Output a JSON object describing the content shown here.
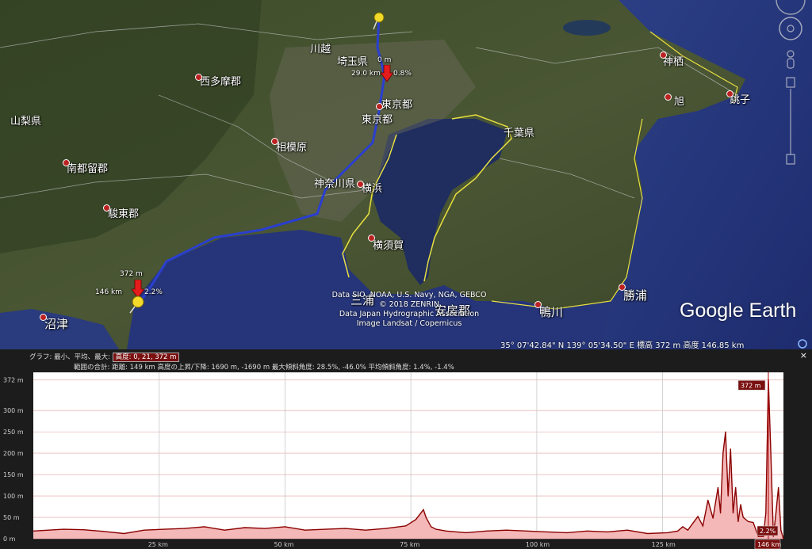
{
  "map": {
    "places": [
      {
        "name": "川越",
        "id": "kawagoe"
      },
      {
        "name": "埼玉県",
        "id": "saitama"
      },
      {
        "name": "神栖",
        "id": "kamisu"
      },
      {
        "name": "西多摩郡",
        "id": "nishitama"
      },
      {
        "name": "東京都",
        "id": "tokyo1"
      },
      {
        "name": "東京都",
        "id": "tokyo2"
      },
      {
        "name": "旭",
        "id": "asahi"
      },
      {
        "name": "銚子",
        "id": "choshi"
      },
      {
        "name": "山梨県",
        "id": "yamanashi"
      },
      {
        "name": "千葉県",
        "id": "chiba"
      },
      {
        "name": "相模原",
        "id": "sagamihara"
      },
      {
        "name": "南都留郡",
        "id": "minamitsuru"
      },
      {
        "name": "神奈川県",
        "id": "kanagawa"
      },
      {
        "name": "横浜",
        "id": "yokohama"
      },
      {
        "name": "駿東郡",
        "id": "sunto"
      },
      {
        "name": "横須賀",
        "id": "yokosuka"
      },
      {
        "name": "勝浦",
        "id": "katsuura"
      },
      {
        "name": "三浦",
        "id": "miura"
      },
      {
        "name": "安房郡",
        "id": "awa"
      },
      {
        "name": "鴨川",
        "id": "kamogawa"
      },
      {
        "name": "沼津",
        "id": "numazu"
      }
    ],
    "markers": {
      "top_altitude": "0 m",
      "top_distance": "29.0 km",
      "top_grade": "0.8%",
      "bottom_altitude": "372 m",
      "bottom_distance": "146 km",
      "bottom_grade": "2.2%"
    },
    "attribution": [
      "Data SIO, NOAA, U.S. Navy, NGA, GEBCO",
      "© 2018 ZENRIN",
      "Data Japan Hydrographic Association",
      "Image Landsat / Copernicus"
    ],
    "logo": "Google Earth",
    "status": "35° 07'42.84\" N  139° 05'34.50\" E  標高   372 m    高度 146.85 km"
  },
  "panel": {
    "line1_prefix": "グラフ: 最小、平均、最大:",
    "line1_badge": "高度: 0, 21, 372 m",
    "line2_prefix": "範囲の合計:",
    "line2_text": "距離: 149 km  高度の上昇/下降: 1690 m, -1690 m  最大傾斜角度: 28.5%, -46.0%  平均傾斜角度: 1.4%, -1.4%",
    "close": "×"
  },
  "chart_data": {
    "type": "area",
    "title": "",
    "xlabel": "",
    "ylabel": "",
    "ylim": [
      0,
      380
    ],
    "xlim": [
      0,
      149
    ],
    "y_ticks": [
      "0 m",
      "50 m",
      "100 m",
      "150 m",
      "200 m",
      "250 m",
      "300 m",
      "372 m"
    ],
    "y_tick_values": [
      0,
      50,
      100,
      150,
      200,
      250,
      300,
      372
    ],
    "x_ticks": [
      "25 km",
      "50 km",
      "75 km",
      "100 km",
      "125 km"
    ],
    "x_tick_values": [
      25,
      50,
      75,
      100,
      125
    ],
    "cursor_x_label": "146 km",
    "cursor_max_label": "372 m",
    "cursor_grade_label": "2.2%",
    "fill_color": "#f4b8b8",
    "line_color": "#8b0000",
    "series": [
      {
        "x": [
          0,
          3,
          6,
          10,
          14,
          18,
          22,
          26,
          30,
          34,
          38,
          42,
          46,
          50,
          54,
          58,
          62,
          66,
          70,
          74,
          76,
          77.5,
          78,
          79,
          80,
          82,
          86,
          90,
          94,
          98,
          102,
          106,
          110,
          114,
          118,
          122,
          126,
          128,
          129,
          130,
          131,
          132,
          133,
          134,
          135,
          136,
          136.5,
          137,
          137.5,
          138,
          138.5,
          139,
          139.5,
          140,
          140.5,
          141,
          142,
          143,
          144,
          145,
          145.5,
          146,
          146.5,
          147,
          147.5,
          148,
          148.5,
          149
        ],
        "y": [
          18,
          20,
          22,
          21,
          17,
          12,
          20,
          22,
          24,
          28,
          20,
          26,
          24,
          28,
          20,
          22,
          24,
          20,
          24,
          30,
          45,
          68,
          50,
          28,
          22,
          18,
          14,
          18,
          20,
          18,
          16,
          14,
          18,
          16,
          20,
          12,
          14,
          18,
          28,
          20,
          36,
          52,
          30,
          90,
          48,
          120,
          60,
          200,
          250,
          100,
          210,
          60,
          120,
          40,
          80,
          50,
          40,
          38,
          5,
          5,
          60,
          372,
          200,
          5,
          60,
          120,
          20,
          0
        ]
      }
    ]
  }
}
